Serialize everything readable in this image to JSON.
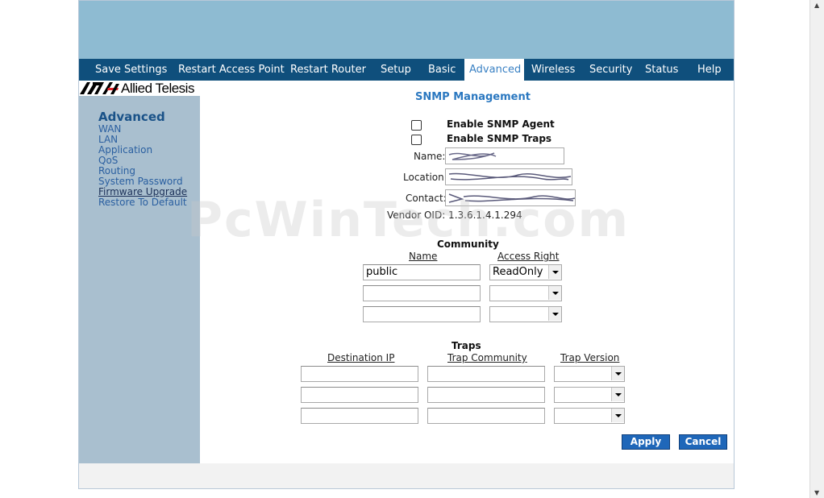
{
  "nav": {
    "items": [
      {
        "label": "Save Settings"
      },
      {
        "label": "Restart Access Point"
      },
      {
        "label": "Restart Router"
      },
      {
        "label": "Setup"
      },
      {
        "label": "Basic"
      },
      {
        "label": "Advanced"
      },
      {
        "label": "Wireless"
      },
      {
        "label": "Security"
      },
      {
        "label": "Status"
      },
      {
        "label": "Help"
      }
    ],
    "active": "Advanced"
  },
  "brand": {
    "name": "Allied Telesis"
  },
  "sidebar": {
    "title": "Advanced",
    "items": [
      {
        "label": "WAN"
      },
      {
        "label": "LAN"
      },
      {
        "label": "Application"
      },
      {
        "label": "QoS"
      },
      {
        "label": "Routing"
      },
      {
        "label": "System Password"
      },
      {
        "label": "Firmware Upgrade"
      },
      {
        "label": "Restore To Default"
      }
    ]
  },
  "snmp": {
    "title": "SNMP Management",
    "enable_agent_label": "Enable SNMP Agent",
    "enable_traps_label": "Enable SNMP Traps",
    "enable_agent_checked": false,
    "enable_traps_checked": false,
    "name_label": "Name:",
    "location_label": "Location:",
    "contact_label": "Contact:",
    "vendor_oid": "Vendor OID: 1.3.6.1.4.1.294"
  },
  "community": {
    "title": "Community",
    "col_name": "Name",
    "col_access": "Access Right",
    "rows": [
      {
        "name": "public",
        "access": "ReadOnly"
      },
      {
        "name": "",
        "access": ""
      },
      {
        "name": "",
        "access": ""
      }
    ]
  },
  "traps": {
    "title": "Traps",
    "col_dest": "Destination IP",
    "col_community": "Trap Community",
    "col_version": "Trap Version",
    "rows": [
      {
        "dest": "",
        "community": "",
        "version": ""
      },
      {
        "dest": "",
        "community": "",
        "version": ""
      },
      {
        "dest": "",
        "community": "",
        "version": ""
      }
    ]
  },
  "buttons": {
    "apply": "Apply",
    "cancel": "Cancel"
  },
  "watermark": "PcWinTech.com",
  "colors": {
    "nav_bg": "#0f4f7c",
    "banner": "#8ebbd2",
    "sidebar": "#a9bfcf",
    "accent": "#2b78c0",
    "button": "#1f67b9"
  }
}
